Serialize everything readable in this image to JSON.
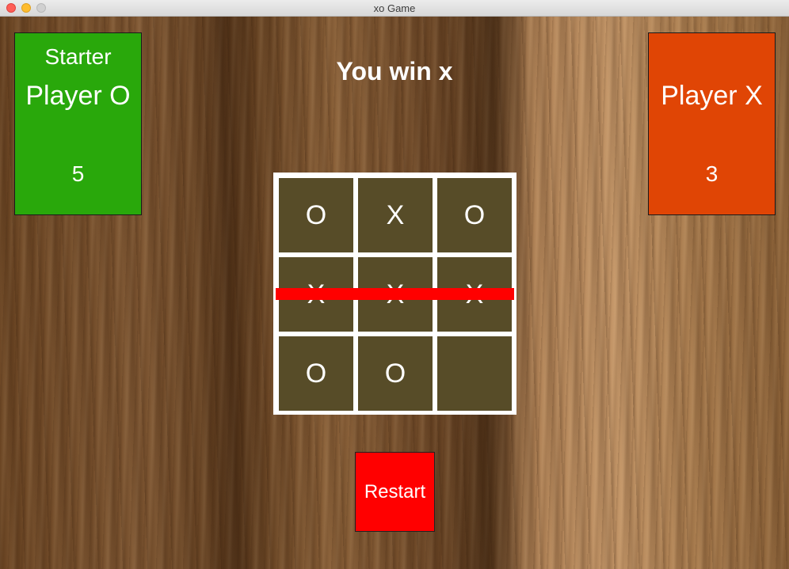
{
  "window": {
    "title": "xo Game"
  },
  "colors": {
    "player_o_card": "#29a80b",
    "player_x_card": "#e04505",
    "cell": "#574c28",
    "board_frame": "#ffffff",
    "win_line": "#ff0000",
    "restart_button": "#ff0000"
  },
  "player_o": {
    "starter_label": "Starter",
    "name": "Player O",
    "score": "5"
  },
  "player_x": {
    "name": "Player X",
    "score": "3"
  },
  "status": "You win x",
  "board": {
    "cells": [
      "O",
      "X",
      "O",
      "X",
      "X",
      "X",
      "O",
      "O",
      ""
    ],
    "winning_row": 2
  },
  "restart_label": "Restart"
}
